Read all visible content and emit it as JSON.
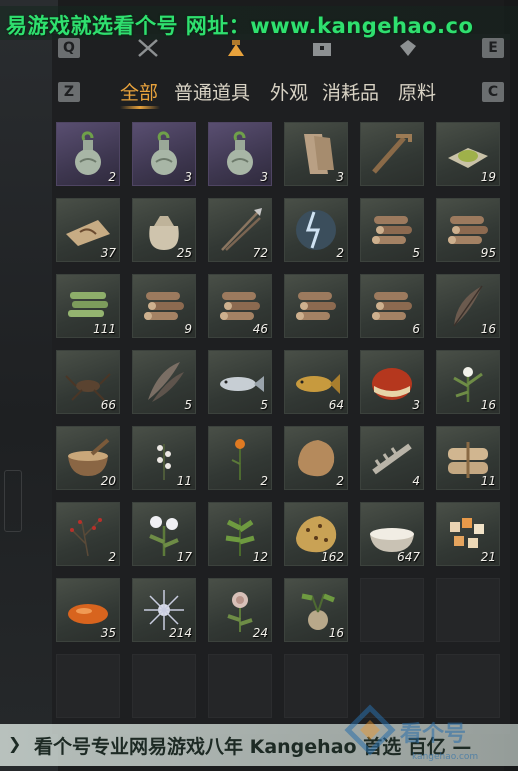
{
  "watermark": {
    "top": "易游戏就选看个号  网址：www.kangehao.co",
    "bottom": "看个号专业网易游戏八年  Kangehao 首选 百亿 —",
    "logo": "看个号",
    "logo_sub": "kangehao.com"
  },
  "category_keys": {
    "left": "Q",
    "right": "E"
  },
  "tab_keys": {
    "left": "Z",
    "right": "C"
  },
  "category_icons": [
    "crossed-swords-icon",
    "backpack-icon",
    "chest-icon",
    "gem-icon"
  ],
  "active_category": "backpack-icon",
  "tabs": [
    {
      "label": "全部",
      "active": true
    },
    {
      "label": "普通道具",
      "active": false
    },
    {
      "label": "外观",
      "active": false
    },
    {
      "label": "消耗品",
      "active": false
    },
    {
      "label": "原料",
      "active": false
    }
  ],
  "accent_color": "#e8a23c",
  "items": [
    {
      "icon": "vase-icon",
      "count": "2",
      "rarity": "purple"
    },
    {
      "icon": "vase-icon",
      "count": "3",
      "rarity": "purple"
    },
    {
      "icon": "vase-icon",
      "count": "3",
      "rarity": "purple"
    },
    {
      "icon": "wooden-planks-icon",
      "count": "3",
      "rarity": "green"
    },
    {
      "icon": "wooden-tool-icon",
      "count": "",
      "rarity": "green"
    },
    {
      "icon": "herb-powder-icon",
      "count": "19",
      "rarity": "green"
    },
    {
      "icon": "map-scroll-icon",
      "count": "37",
      "rarity": "green"
    },
    {
      "icon": "cloth-sack-icon",
      "count": "25",
      "rarity": "green"
    },
    {
      "icon": "arrows-icon",
      "count": "72",
      "rarity": "green"
    },
    {
      "icon": "lightning-essence-icon",
      "count": "2",
      "rarity": "green"
    },
    {
      "icon": "log-pile-icon",
      "count": "5",
      "rarity": "green"
    },
    {
      "icon": "log-pile-icon",
      "count": "95",
      "rarity": "green"
    },
    {
      "icon": "bamboo-bundle-icon",
      "count": "111",
      "rarity": "green"
    },
    {
      "icon": "log-pile-icon",
      "count": "9",
      "rarity": "green"
    },
    {
      "icon": "log-pile-icon",
      "count": "46",
      "rarity": "green"
    },
    {
      "icon": "log-pile-icon",
      "count": "",
      "rarity": "green"
    },
    {
      "icon": "log-pile-icon",
      "count": "6",
      "rarity": "green"
    },
    {
      "icon": "feather-icon",
      "count": "16",
      "rarity": "green"
    },
    {
      "icon": "insect-icon",
      "count": "66",
      "rarity": "green"
    },
    {
      "icon": "feathers-bundle-icon",
      "count": "5",
      "rarity": "green"
    },
    {
      "icon": "silver-fish-icon",
      "count": "5",
      "rarity": "green"
    },
    {
      "icon": "golden-fish-icon",
      "count": "64",
      "rarity": "green"
    },
    {
      "icon": "chestnut-icon",
      "count": "3",
      "rarity": "green"
    },
    {
      "icon": "white-flower-herb-icon",
      "count": "16",
      "rarity": "green"
    },
    {
      "icon": "mortar-bowl-icon",
      "count": "20",
      "rarity": "green"
    },
    {
      "icon": "white-blossom-sprig-icon",
      "count": "11",
      "rarity": "green"
    },
    {
      "icon": "orange-flower-icon",
      "count": "2",
      "rarity": "green"
    },
    {
      "icon": "fur-pelt-icon",
      "count": "2",
      "rarity": "green"
    },
    {
      "icon": "bone-icon",
      "count": "4",
      "rarity": "green"
    },
    {
      "icon": "tied-bundle-icon",
      "count": "11",
      "rarity": "green"
    },
    {
      "icon": "red-berry-branch-icon",
      "count": "2",
      "rarity": "green"
    },
    {
      "icon": "white-daisy-herb-icon",
      "count": "17",
      "rarity": "green"
    },
    {
      "icon": "green-herb-icon",
      "count": "12",
      "rarity": "green"
    },
    {
      "icon": "leopard-fur-icon",
      "count": "162",
      "rarity": "green"
    },
    {
      "icon": "rice-bowl-icon",
      "count": "647",
      "rarity": "green"
    },
    {
      "icon": "sweets-pile-icon",
      "count": "21",
      "rarity": "green"
    },
    {
      "icon": "orange-stone-icon",
      "count": "35",
      "rarity": "green"
    },
    {
      "icon": "spiky-white-flower-icon",
      "count": "214",
      "rarity": "green"
    },
    {
      "icon": "pale-rose-icon",
      "count": "24",
      "rarity": "green"
    },
    {
      "icon": "root-plant-icon",
      "count": "16",
      "rarity": "green"
    }
  ],
  "empty_slots": 8
}
